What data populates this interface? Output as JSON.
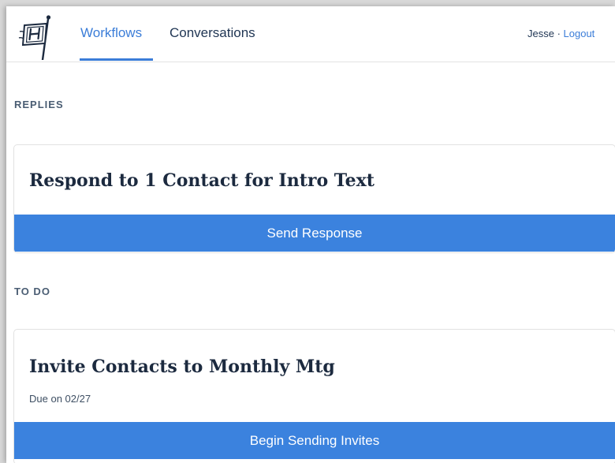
{
  "nav": {
    "tabs": [
      {
        "label": "Workflows",
        "active": true
      },
      {
        "label": "Conversations",
        "active": false
      }
    ],
    "user": {
      "name": "Jesse",
      "separator": " · ",
      "logout_label": "Logout"
    },
    "logo_icon": "flag-h-logo-icon"
  },
  "sections": {
    "replies": {
      "label": "REPLIES",
      "card": {
        "title": "Respond to 1 Contact for Intro Text",
        "button_label": "Send Response"
      }
    },
    "todo": {
      "label": "TO DO",
      "card": {
        "title": "Invite Contacts to Monthly Mtg",
        "due": "Due on 02/27",
        "button_label": "Begin Sending Invites"
      }
    }
  },
  "colors": {
    "accent": "#3b7dd8",
    "button": "#3b82de",
    "navy": "#1f3553"
  }
}
